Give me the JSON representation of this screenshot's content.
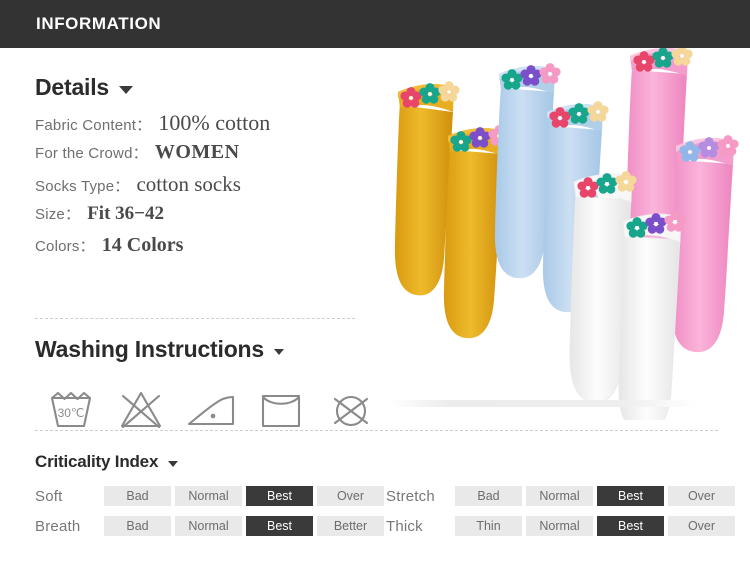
{
  "header": {
    "title": "INFORMATION"
  },
  "details": {
    "heading": "Details",
    "caret_icon": "chevron-down-icon",
    "specs": [
      {
        "label": "Fabric Content：",
        "value": "100% cotton"
      },
      {
        "label": "For the Crowd：",
        "value": "WOMEN"
      },
      {
        "label": "Socks Type：",
        "value": "cotton socks"
      },
      {
        "label": "Size：",
        "value": "Fit 36−42"
      },
      {
        "label": "Colors：",
        "value": "14 Colors"
      }
    ]
  },
  "washing": {
    "heading": "Washing Instructions",
    "caret_icon": "chevron-down-icon",
    "icons": [
      {
        "name": "wash-30c-icon",
        "label": "30℃"
      },
      {
        "name": "do-not-bleach-icon",
        "label": ""
      },
      {
        "name": "iron-low-icon",
        "label": ""
      },
      {
        "name": "drip-dry-icon",
        "label": ""
      },
      {
        "name": "do-not-dry-clean-icon",
        "label": ""
      }
    ]
  },
  "criticality": {
    "heading": "Criticality Index",
    "caret_icon": "chevron-down-icon",
    "rows": [
      {
        "label": "Soft",
        "options": [
          "Bad",
          "Normal",
          "Best",
          "Over"
        ],
        "active": 2
      },
      {
        "label": "Stretch",
        "options": [
          "Bad",
          "Normal",
          "Best",
          "Over"
        ],
        "active": 2
      },
      {
        "label": "Breath",
        "options": [
          "Bad",
          "Normal",
          "Best",
          "Better"
        ],
        "active": 2
      },
      {
        "label": "Thick",
        "options": [
          "Thin",
          "Normal",
          "Best",
          "Over"
        ],
        "active": 2
      }
    ]
  },
  "product_image": {
    "name": "socks-product-photo",
    "alt": "Four pairs of flower-trimmed cotton socks",
    "sock_colors": [
      "#e0a81b",
      "#b9d5ee",
      "#ffffff",
      "#f2a0cd"
    ],
    "flower_colors": [
      "#e03a5a",
      "#1fa88a",
      "#8a5fd0",
      "#f2c64a",
      "#f598c0"
    ]
  },
  "colors": {
    "header_bg": "#333333",
    "badge_active_bg": "#3a3a3a",
    "badge_bg": "#e9e9e9",
    "text_dark": "#2b2b2b",
    "text_muted": "#6f6f6f"
  }
}
